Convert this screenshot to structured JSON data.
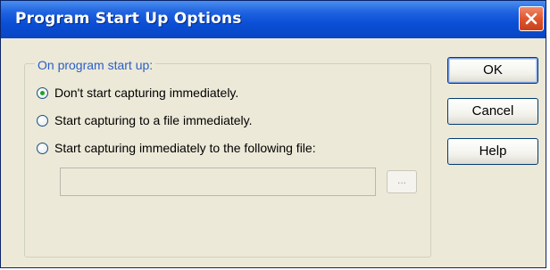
{
  "window": {
    "title": "Program Start Up Options"
  },
  "group": {
    "legend": "On program start up:",
    "options": [
      {
        "label": "Don't start capturing immediately.",
        "checked": true
      },
      {
        "label": "Start capturing to a file immediately.",
        "checked": false
      },
      {
        "label": "Start capturing immediately to the following file:",
        "checked": false
      }
    ],
    "file_path": "",
    "browse_label": "..."
  },
  "buttons": {
    "ok": "OK",
    "cancel": "Cancel",
    "help": "Help"
  },
  "icons": {
    "close": "close-icon",
    "radio": "radio-icon"
  },
  "colors": {
    "title_bar": "#0a4fd6",
    "close_button": "#e0562e",
    "dialog_bg": "#ece9d8",
    "group_legend": "#2b5ec9",
    "radio_check": "#21a121"
  }
}
